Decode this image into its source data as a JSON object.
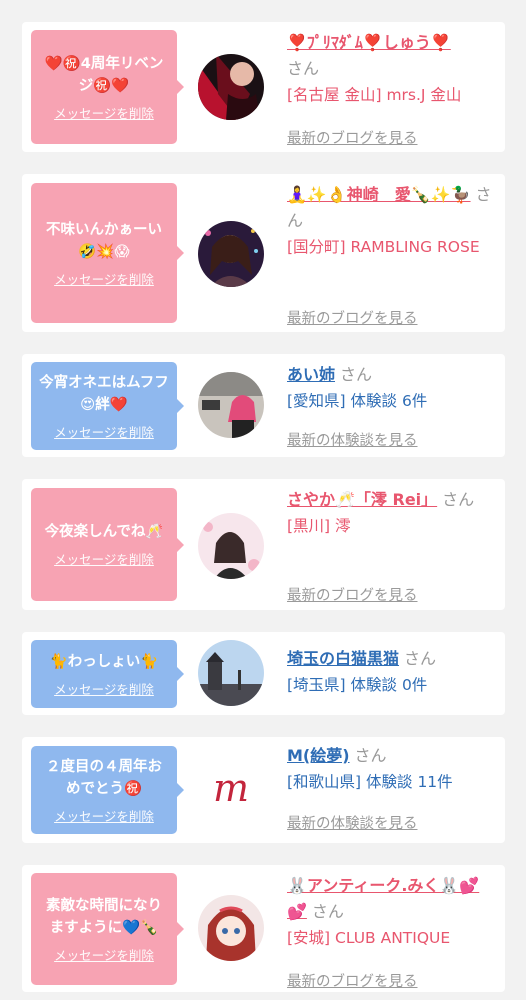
{
  "delete_label": "メッセージを削除",
  "san": "さん",
  "cards": [
    {
      "message": "❤️㊗️4周年リベンジ㊗️❤️",
      "name": "❣️ﾌﾟﾘﾏﾀﾞﾑ❣️しゅう❣️",
      "shop": "[名古屋 金山] mrs.J 金山",
      "link": "最新のブログを見る",
      "theme": "pink"
    },
    {
      "message": "不味いんかぁーい🤣💥😱",
      "name": "🧘‍♀️✨👌神崎　愛🍾✨🦆",
      "shop": "[国分町] RAMBLING ROSE",
      "link": "最新のブログを見る",
      "theme": "pink"
    },
    {
      "message": "今宵オネエはムフフ😍絆❤️",
      "name": "あい姉",
      "shop": "[愛知県] 体験談 6件",
      "link": "最新の体験談を見る",
      "theme": "blue"
    },
    {
      "message": "今夜楽しんでね🥂",
      "name": "さやか🥂「澪 Rei」",
      "shop": "[黒川] 澪",
      "link": "最新のブログを見る",
      "theme": "pink"
    },
    {
      "message": "🐈わっしょい🐈",
      "name": "埼玉の白猫黒猫",
      "shop": "[埼玉県] 体験談 0件",
      "link": "",
      "theme": "blue"
    },
    {
      "message": "２度目の４周年おめでとう㊗️",
      "name": "M(絵夢)",
      "shop": "[和歌山県] 体験談 11件",
      "link": "最新の体験談を見る",
      "theme": "blue"
    },
    {
      "message": "素敵な時間になりますように💙🍾",
      "name": "🐰アンティーク.みく🐰💕💕",
      "shop": "[安城] CLUB ANTIQUE",
      "link": "最新のブログを見る",
      "theme": "pink"
    }
  ]
}
